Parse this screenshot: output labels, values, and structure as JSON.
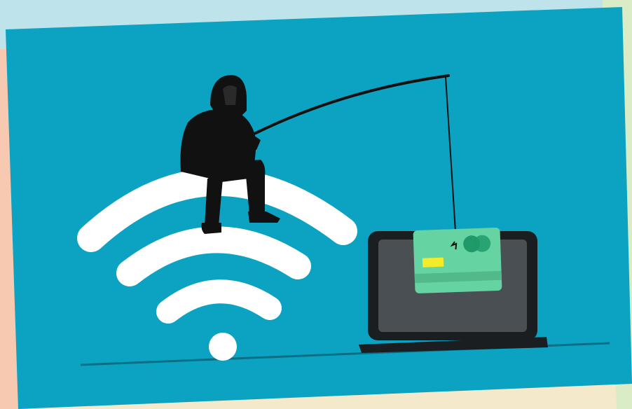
{
  "scene": {
    "subject": "phishing-over-wifi",
    "icons": [
      "hooded-hacker-icon",
      "fishing-rod-icon",
      "wifi-icon",
      "laptop-icon",
      "credit-card-icon"
    ]
  },
  "colors": {
    "backdrop_top": "#bfe3ea",
    "backdrop_left": "#f7c9b1",
    "backdrop_right": "#d9ecc6",
    "backdrop_bottom": "#f5e9cc",
    "panel": "#0ba3c1",
    "wifi": "#ffffff",
    "hacker": "#111111",
    "laptop_frame": "#1b1e21",
    "laptop_screen": "#4a4f54",
    "card": "#66d3a3",
    "card_stripe": "#52b98c",
    "card_chip": "#f2ec2a",
    "card_logo": "#1f9a68",
    "ground_line": "#0a6f84"
  }
}
